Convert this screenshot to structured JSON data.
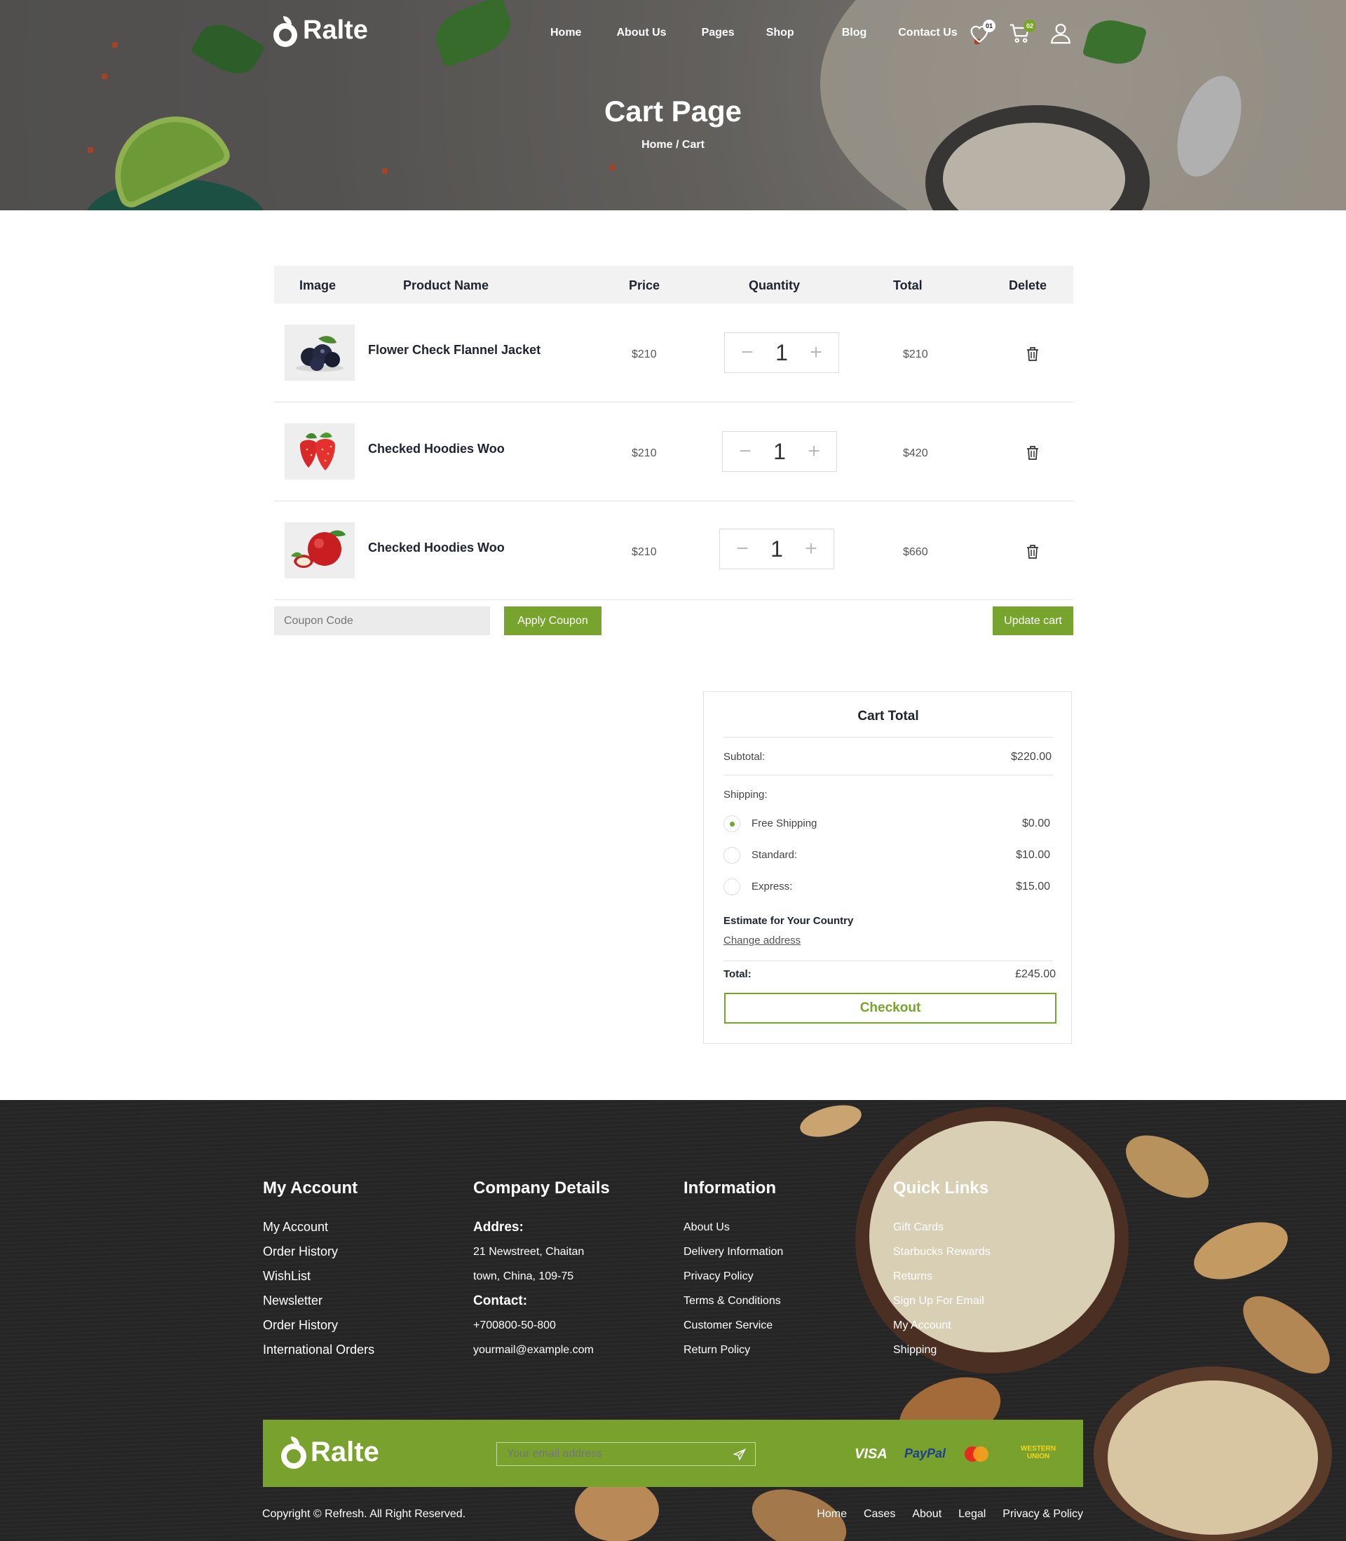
{
  "brand": {
    "name": "Ralte"
  },
  "nav": {
    "items": [
      "Home",
      "About Us",
      "Pages",
      "Shop",
      "Blog",
      "Contact Us"
    ]
  },
  "header_icons": {
    "wishlist_count": "01",
    "cart_count": "02",
    "wishlist_icon": "heart-icon",
    "cart_icon": "cart-icon",
    "user_icon": "user-icon"
  },
  "hero": {
    "title": "Cart Page",
    "breadcrumb": "Home / Cart"
  },
  "table": {
    "headers": [
      "Image",
      "Product Name",
      "Price",
      "Quantity",
      "Total",
      "Delete"
    ],
    "rows": [
      {
        "name": "Flower Check Flannel Jacket",
        "price": "$210",
        "qty": "1",
        "total": "$210",
        "image": "blueberries"
      },
      {
        "name": "Checked Hoodies Woo",
        "price": "$210",
        "qty": "1",
        "total": "$420",
        "image": "strawberries"
      },
      {
        "name": "Checked Hoodies Woo",
        "price": "$210",
        "qty": "1",
        "total": "$660",
        "image": "apples"
      }
    ]
  },
  "coupon": {
    "placeholder": "Coupon Code",
    "apply_label": "Apply Coupon",
    "update_label": "Update cart"
  },
  "cart_total": {
    "title": "Cart Total",
    "subtotal_label": "Subtotal:",
    "subtotal_value": "$220.00",
    "shipping_label": "Shipping:",
    "options": [
      {
        "label": "Free Shipping",
        "value": "$0.00",
        "selected": true
      },
      {
        "label": "Standard:",
        "value": "$10.00",
        "selected": false
      },
      {
        "label": "Express:",
        "value": "$15.00",
        "selected": false
      }
    ],
    "estimate_label": "Estimate for Your Country",
    "change_address": "Change address",
    "total_label": "Total:",
    "total_value": "£245.00",
    "checkout_label": "Checkout"
  },
  "footer": {
    "my_account": {
      "title": "My Account",
      "items": [
        "My Account",
        "Order History",
        "WishList",
        "Newsletter",
        "Order History",
        "International Orders"
      ]
    },
    "company": {
      "title": "Company Details",
      "address_label": "Addres:",
      "address_line1": "21 Newstreet, Chaitan",
      "address_line2": "town, China, 109-75",
      "contact_label": "Contact:",
      "phone": "+700800-50-800",
      "email": "yourmail@example.com"
    },
    "information": {
      "title": "Information",
      "items": [
        "About Us",
        "Delivery Information",
        "Privacy Policy",
        "Terms & Conditions",
        "Customer Service",
        "Return Policy"
      ]
    },
    "quick_links": {
      "title": "Quick Links",
      "items": [
        "Gift Cards",
        "Starbucks Rewards",
        "Returns",
        "Sign Up For Email",
        "My Account",
        "Shipping"
      ]
    },
    "newsletter": {
      "placeholder": "Your email address"
    },
    "payments": [
      "VISA",
      "PayPal",
      "MasterCard",
      "WESTERN UNION"
    ],
    "copyright": "Copyright © Refresh. All Right Reserved.",
    "bottom_links": [
      "Home",
      "Cases",
      "About",
      "Legal",
      "Privacy & Policy"
    ]
  }
}
